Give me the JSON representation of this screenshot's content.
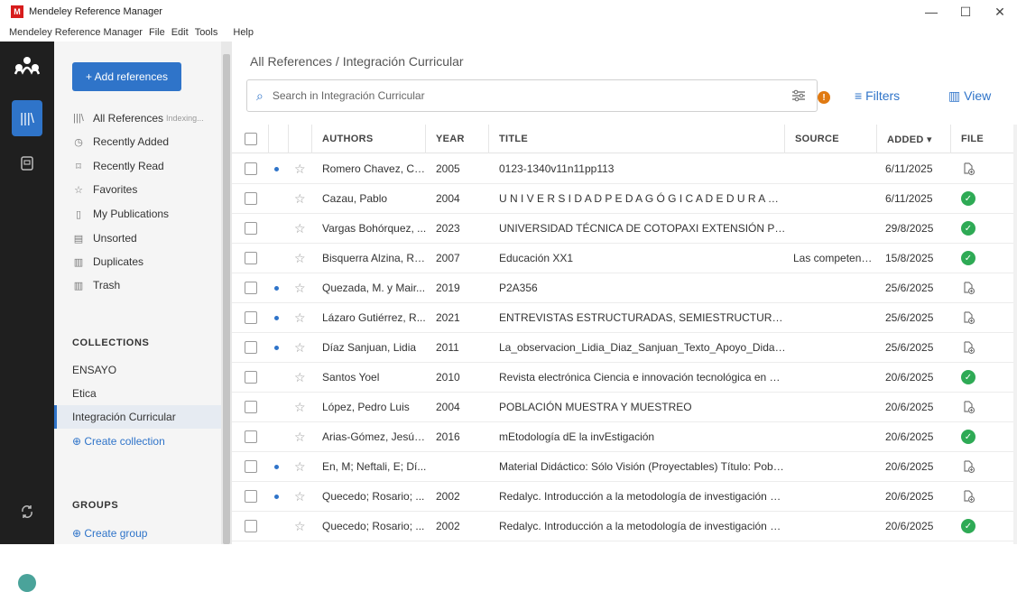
{
  "window": {
    "title": "Mendeley Reference Manager",
    "minimize": "—",
    "maximize": "☐",
    "close": "✕"
  },
  "menu": [
    "Mendeley Reference Manager",
    "File",
    "Edit",
    "Tools",
    "Help"
  ],
  "sidebar": {
    "add_button": "+ Add references",
    "items": [
      {
        "label": "All References",
        "sub": "Indexing..."
      },
      {
        "label": "Recently Added"
      },
      {
        "label": "Recently Read"
      },
      {
        "label": "Favorites"
      },
      {
        "label": "My Publications"
      },
      {
        "label": "Unsorted"
      },
      {
        "label": "Duplicates"
      },
      {
        "label": "Trash"
      }
    ],
    "collections_heading": "COLLECTIONS",
    "collections": [
      "ENSAYO",
      "Etica",
      "Integración Curricular"
    ],
    "create_collection": "⊕ Create collection",
    "groups_heading": "GROUPS",
    "create_group": "⊕ Create group"
  },
  "main": {
    "breadcrumb": "All References / Integración Curricular",
    "search_placeholder": "Search in Integración Curricular",
    "filters": "Filters",
    "view": "View",
    "headers": {
      "authors": "AUTHORS",
      "year": "YEAR",
      "title": "TITLE",
      "source": "SOURCE",
      "added": "ADDED ▾",
      "file": "FILE"
    },
    "rows": [
      {
        "unread": true,
        "authors": "Romero Chavez, Cri...",
        "year": "2005",
        "title": "0123-1340v11n11pp113",
        "source": "",
        "added": "6/11/2025",
        "file": "none"
      },
      {
        "unread": false,
        "authors": "Cazau, Pablo",
        "year": "2004",
        "title": "U N I V E R S I D A D P E D A G Ó G I C A D E D U R A N ...",
        "source": "",
        "added": "6/11/2025",
        "file": "ok"
      },
      {
        "unread": false,
        "authors": "Vargas Bohórquez, ...",
        "year": "2023",
        "title": "UNIVERSIDAD TÉCNICA DE COTOPAXI EXTENSIÓN PU...",
        "source": "",
        "added": "29/8/2025",
        "file": "ok"
      },
      {
        "unread": false,
        "authors": "Bisquerra Alzina, Ra...",
        "year": "2007",
        "title": "Educación XX1",
        "source": "Las competenc...",
        "added": "15/8/2025",
        "file": "ok"
      },
      {
        "unread": true,
        "authors": "Quezada, M. y Mair...",
        "year": "2019",
        "title": "P2A356",
        "source": "",
        "added": "25/6/2025",
        "file": "none"
      },
      {
        "unread": true,
        "authors": "Lázaro Gutiérrez, R...",
        "year": "2021",
        "title": "ENTREVISTAS ESTRUCTURADAS, SEMIESTRUCTURA...",
        "source": "",
        "added": "25/6/2025",
        "file": "none"
      },
      {
        "unread": true,
        "authors": "Díaz Sanjuan, Lidia",
        "year": "2011",
        "title": "La_observacion_Lidia_Diaz_Sanjuan_Texto_Apoyo_Didacti...",
        "source": "",
        "added": "25/6/2025",
        "file": "none"
      },
      {
        "unread": false,
        "authors": "Santos Yoel",
        "year": "2010",
        "title": "Revista electrónica Ciencia e innovación tecnológica en el ...",
        "source": "",
        "added": "20/6/2025",
        "file": "ok"
      },
      {
        "unread": false,
        "authors": "López, Pedro Luis",
        "year": "2004",
        "title": "POBLACIÓN MUESTRA Y MUESTREO",
        "source": "",
        "added": "20/6/2025",
        "file": "none"
      },
      {
        "unread": false,
        "authors": "Arias-Gómez, Jesús...",
        "year": "2016",
        "title": "mEtodología dE la invEstigación",
        "source": "",
        "added": "20/6/2025",
        "file": "ok"
      },
      {
        "unread": true,
        "authors": "En, M; Neftali, E; Dí...",
        "year": "",
        "title": "Material Didáctico: Sólo Visión (Proyectables) Título: Pobla...",
        "source": "",
        "added": "20/6/2025",
        "file": "none"
      },
      {
        "unread": true,
        "authors": "Quecedo; Rosario; ...",
        "year": "2002",
        "title": "Redalyc. Introducción a la metodología de investigación cu...",
        "source": "",
        "added": "20/6/2025",
        "file": "none"
      },
      {
        "unread": false,
        "authors": "Quecedo; Rosario; ...",
        "year": "2002",
        "title": "Redalyc. Introducción a la metodología de investigación cu...",
        "source": "",
        "added": "20/6/2025",
        "file": "ok"
      }
    ]
  }
}
